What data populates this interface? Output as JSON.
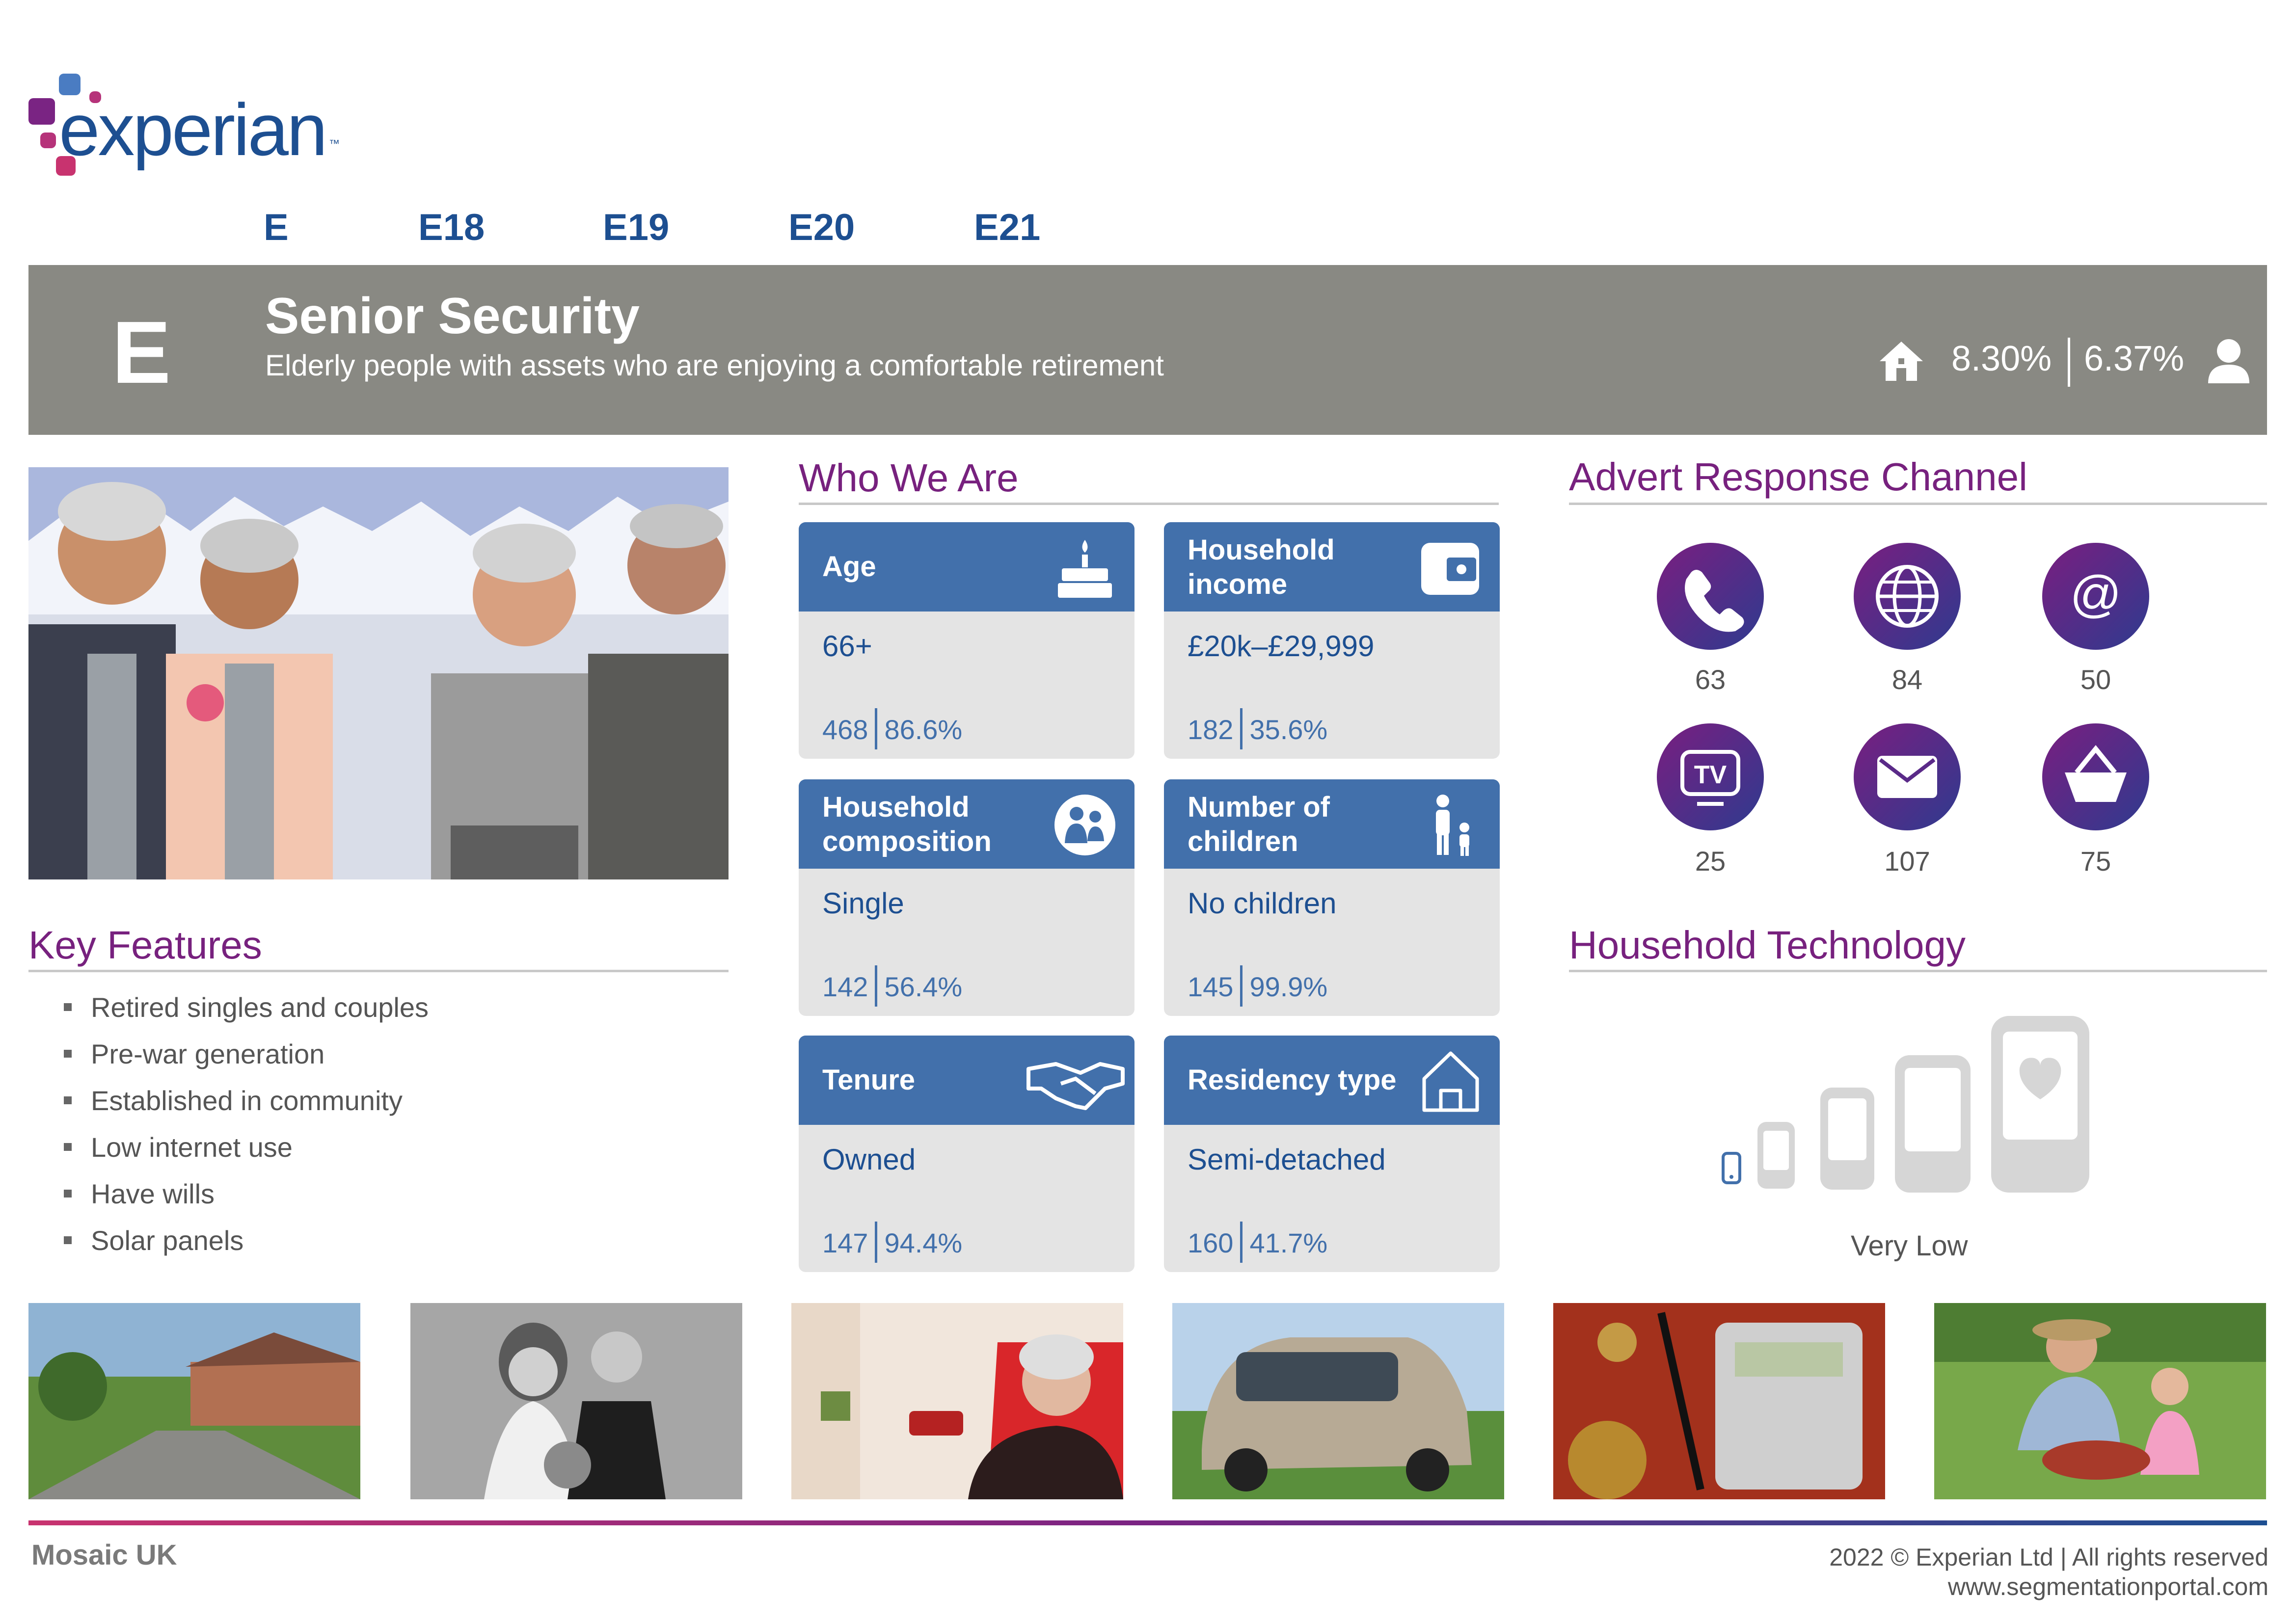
{
  "logo": {
    "text": "experian",
    "tm": "™"
  },
  "tabs": [
    "E",
    "E18",
    "E19",
    "E20",
    "E21"
  ],
  "banner": {
    "letter": "E",
    "title": "Senior Security",
    "subtitle": "Elderly people with assets who are enjoying a comfortable retirement",
    "household_pct": "8.30%",
    "person_pct": "6.37%"
  },
  "who_we_are": {
    "heading": "Who We Are",
    "cards": [
      {
        "title": "Age",
        "value": "66+",
        "index": "468",
        "pct": "86.6%",
        "icon": "birthday-cake-icon"
      },
      {
        "title": "Household income",
        "value": "£20k–£29,999",
        "index": "182",
        "pct": "35.6%",
        "icon": "wallet-icon"
      },
      {
        "title": "Household composition",
        "value": "Single",
        "index": "142",
        "pct": "56.4%",
        "icon": "family-icon"
      },
      {
        "title": "Number of children",
        "value": "No children",
        "index": "145",
        "pct": "99.9%",
        "icon": "parent-child-icon"
      },
      {
        "title": "Tenure",
        "value": "Owned",
        "index": "147",
        "pct": "94.4%",
        "icon": "handshake-icon"
      },
      {
        "title": "Residency type",
        "value": "Semi-detached",
        "index": "160",
        "pct": "41.7%",
        "icon": "house-outline-icon"
      }
    ]
  },
  "key_features": {
    "heading": "Key Features",
    "items": [
      "Retired singles and couples",
      "Pre-war generation",
      "Established in community",
      "Low internet use",
      "Have wills",
      "Solar panels"
    ]
  },
  "advert": {
    "heading": "Advert Response Channel",
    "channels": [
      {
        "icon": "phone-icon",
        "value": "63"
      },
      {
        "icon": "globe-icon",
        "value": "84"
      },
      {
        "icon": "email-at-icon",
        "value": "50"
      },
      {
        "icon": "tv-icon",
        "value": "25"
      },
      {
        "icon": "envelope-icon",
        "value": "107"
      },
      {
        "icon": "shopping-basket-icon",
        "value": "75"
      }
    ]
  },
  "technology": {
    "heading": "Household Technology",
    "level": "Very Low"
  },
  "footer": {
    "brand": "Mosaic UK",
    "copyright": "2022 © Experian Ltd | All rights reserved",
    "url": "www.segmentationportal.com"
  },
  "colors": {
    "purple": "#77217e",
    "blue": "#1d4f91",
    "card_blue": "#4270ab",
    "banner_grey": "#898983"
  }
}
